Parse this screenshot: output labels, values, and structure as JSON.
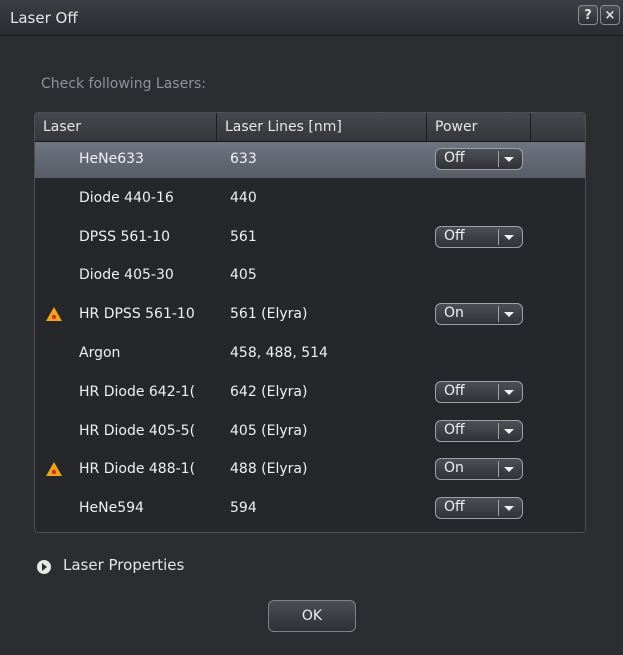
{
  "window": {
    "title": "Laser Off",
    "help_label": "?",
    "close_label": "×"
  },
  "subtitle": "Check following Lasers:",
  "table": {
    "columns": [
      "Laser",
      "Laser Lines [nm]",
      "Power",
      ""
    ],
    "rows": [
      {
        "name": "HeNe633",
        "lines": "633",
        "power": "Off",
        "warning": false,
        "selected": true
      },
      {
        "name": "Diode 440-16",
        "lines": "440",
        "power": null,
        "warning": false,
        "selected": false
      },
      {
        "name": "DPSS 561-10",
        "lines": "561",
        "power": "Off",
        "warning": false,
        "selected": false
      },
      {
        "name": "Diode 405-30",
        "lines": "405",
        "power": null,
        "warning": false,
        "selected": false
      },
      {
        "name": "HR DPSS 561-10",
        "lines": "561 (Elyra)",
        "power": "On",
        "warning": true,
        "selected": false
      },
      {
        "name": "Argon",
        "lines": "458, 488, 514",
        "power": null,
        "warning": false,
        "selected": false
      },
      {
        "name": "HR Diode 642-1(",
        "lines": "642 (Elyra)",
        "power": "Off",
        "warning": false,
        "selected": false
      },
      {
        "name": "HR Diode 405-5(",
        "lines": "405 (Elyra)",
        "power": "Off",
        "warning": false,
        "selected": false
      },
      {
        "name": "HR Diode 488-1(",
        "lines": "488 (Elyra)",
        "power": "On",
        "warning": true,
        "selected": false
      },
      {
        "name": "HeNe594",
        "lines": "594",
        "power": "Off",
        "warning": false,
        "selected": false
      }
    ]
  },
  "properties_label": "Laser Properties",
  "ok_label": "OK",
  "colors": {
    "warning": "#f2a21c",
    "background": "#2b2d31",
    "selected_row": "#646a75"
  }
}
